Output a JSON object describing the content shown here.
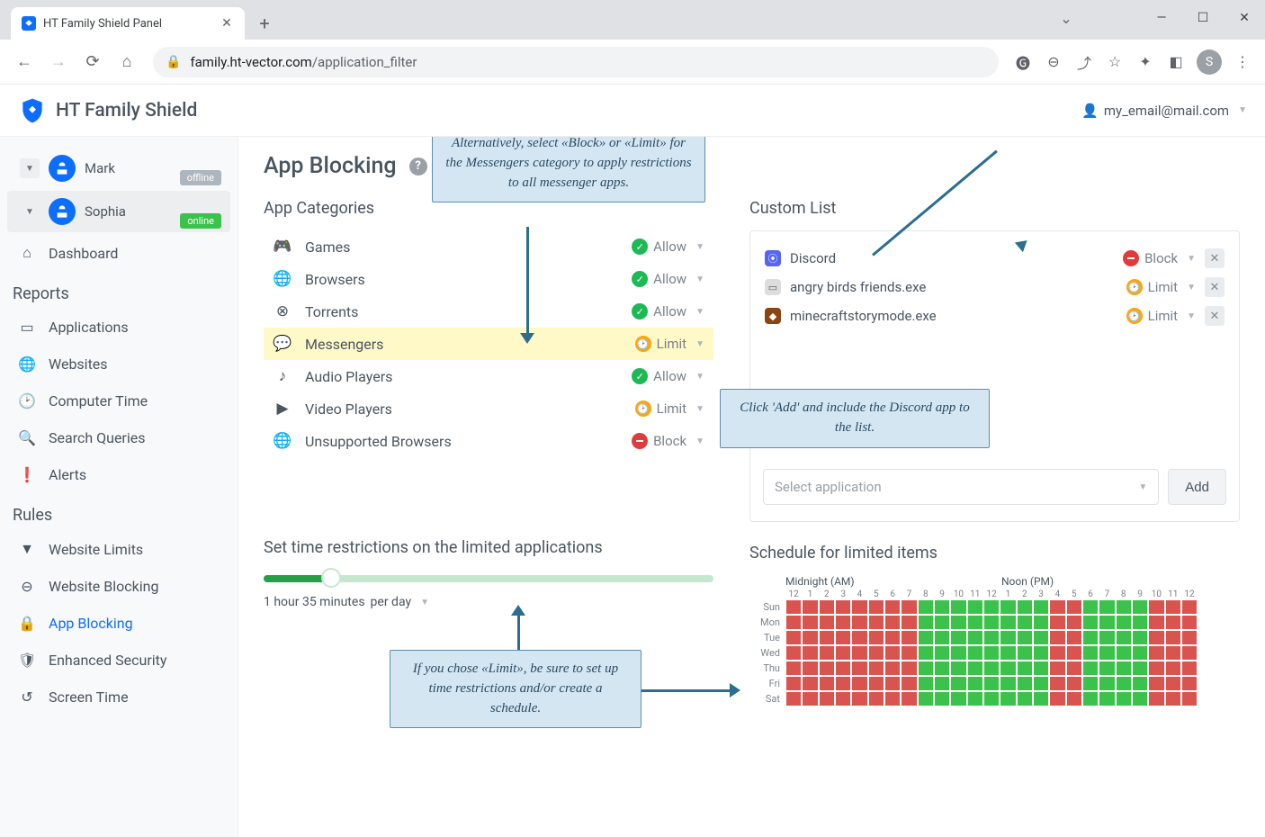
{
  "browser": {
    "tab_title": "HT Family Shield Panel",
    "url_host": "family.ht-vector.com",
    "url_path": "/application_filter",
    "profile_initial": "S"
  },
  "app": {
    "brand": "HT Family Shield",
    "account_email": "my_email@mail.com"
  },
  "sidebar": {
    "users": [
      {
        "name": "Mark",
        "status": "offline"
      },
      {
        "name": "Sophia",
        "status": "online"
      }
    ],
    "dashboard": "Dashboard",
    "section_reports": "Reports",
    "reports": [
      {
        "label": "Applications"
      },
      {
        "label": "Websites"
      },
      {
        "label": "Computer Time"
      },
      {
        "label": "Search Queries"
      },
      {
        "label": "Alerts"
      }
    ],
    "section_rules": "Rules",
    "rules": [
      {
        "label": "Website Limits"
      },
      {
        "label": "Website Blocking"
      },
      {
        "label": "App Blocking"
      },
      {
        "label": "Enhanced Security"
      },
      {
        "label": "Screen Time"
      }
    ]
  },
  "page": {
    "title": "App Blocking",
    "categories_title": "App Categories",
    "categories": [
      {
        "label": "Games",
        "state": "Allow"
      },
      {
        "label": "Browsers",
        "state": "Allow"
      },
      {
        "label": "Torrents",
        "state": "Allow"
      },
      {
        "label": "Messengers",
        "state": "Limit"
      },
      {
        "label": "Audio Players",
        "state": "Allow"
      },
      {
        "label": "Video Players",
        "state": "Limit"
      },
      {
        "label": "Unsupported Browsers",
        "state": "Block"
      }
    ],
    "custom_title": "Custom List",
    "custom_items": [
      {
        "label": "Discord",
        "state": "Block"
      },
      {
        "label": "angry birds friends.exe",
        "state": "Limit"
      },
      {
        "label": "minecraftstorymode.exe",
        "state": "Limit"
      }
    ],
    "select_placeholder": "Select application",
    "add_button": "Add",
    "time_restrict_title": "Set time restrictions on the limited applications",
    "slider_value": "1 hour 35 minutes",
    "slider_unit": "per day",
    "schedule_title": "Schedule for limited items",
    "schedule_am": "Midnight (AM)",
    "schedule_pm": "Noon (PM)",
    "schedule_hours": [
      "12",
      "1",
      "2",
      "3",
      "4",
      "5",
      "6",
      "7",
      "8",
      "9",
      "10",
      "11",
      "12",
      "1",
      "2",
      "3",
      "4",
      "5",
      "6",
      "7",
      "8",
      "9",
      "10",
      "11",
      "12"
    ],
    "schedule_days": [
      "Sun",
      "Mon",
      "Tue",
      "Wed",
      "Thu",
      "Fri",
      "Sat"
    ],
    "schedule_grid": [
      "rrrrrrrrggggggggrrggggrrr",
      "rrrrrrrrggggggggrrggggrrr",
      "rrrrrrrrggggggggrrggggrrr",
      "rrrrrrrrggggggggrrggggrrr",
      "rrrrrrrrggggggggrrggggrrr",
      "rrrrrrrrggggggggrrggggrrr",
      "rrrrrrrrggggggggrrggggrrr"
    ]
  },
  "callouts": {
    "top": "Alternatively, select «Block» or «Limit» for the Messengers category to apply restrictions to all messenger apps.",
    "right": "Click 'Add' and include the Discord app to the list.",
    "bottom": "If you chose «Limit», be sure to set up time restrictions and/or create a schedule."
  }
}
